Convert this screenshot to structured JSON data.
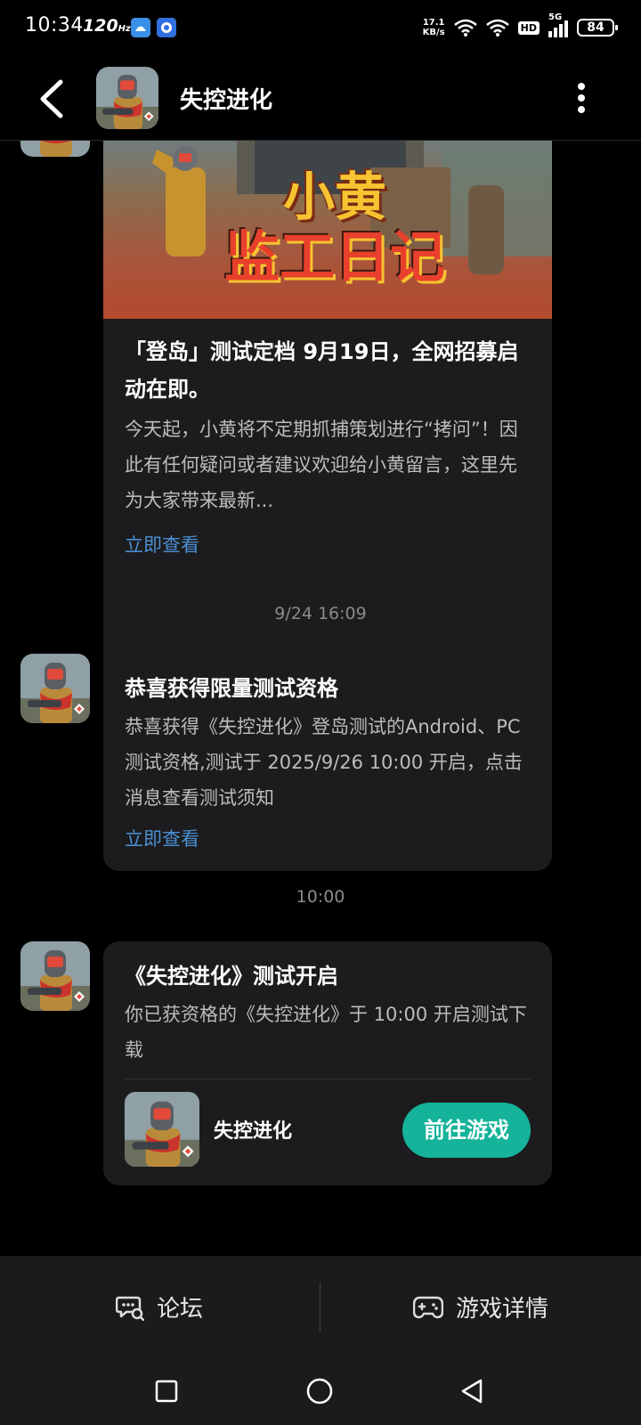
{
  "status_bar": {
    "time": "10:34",
    "refresh_rate": "120",
    "net_speed_value": "17.1",
    "net_speed_unit": "KB/s",
    "hd_label": "HD",
    "network_type": "5G",
    "battery": "84"
  },
  "header": {
    "title": "失控进化"
  },
  "messages": [
    {
      "banner_text_line1": "小黄",
      "banner_text_line2": "监工日记",
      "title": "「登岛」测试定档 9月19日，全网招募启动在即。",
      "body": "今天起，小黄将不定期抓捕策划进行“拷问”！因此有任何疑问或者建议欢迎给小黄留言，这里先为大家带来最新...",
      "link": "立即查看"
    },
    {
      "timestamp": "9/24  16:09",
      "title": "恭喜获得限量测试资格",
      "body": "恭喜获得《失控进化》登岛测试的Android、PC测试资格,测试于 2025/9/26 10:00 开启，点击消息查看测试须知",
      "link": "立即查看"
    },
    {
      "timestamp": "10:00",
      "title": "《失控进化》测试开启",
      "body": "你已获资格的《失控进化》于 10:00 开启测试下载",
      "game_name": "失控进化",
      "button": "前往游戏"
    }
  ],
  "bottom_tabs": [
    {
      "label": "论坛",
      "icon": "forum-chat-icon"
    },
    {
      "label": "游戏详情",
      "icon": "gamepad-icon"
    }
  ],
  "colors": {
    "accent_button": "#14b39a",
    "link": "#4a8ed1",
    "card_bg": "#1c1c1e"
  }
}
